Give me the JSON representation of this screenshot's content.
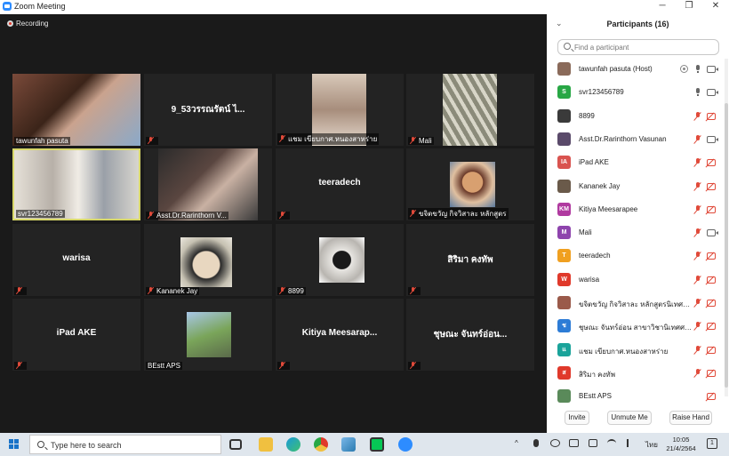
{
  "window": {
    "title": "Zoom Meeting",
    "minimize": "─",
    "restore": "❐",
    "close": "✕"
  },
  "recording_label": "Recording",
  "tiles": [
    {
      "label": "tawunfah pasuta",
      "bigname": "",
      "muted": false,
      "photo": "p1"
    },
    {
      "label": "",
      "bigname": "9_53วรรณรัตน์ ไ...",
      "muted": true,
      "photo": ""
    },
    {
      "label": "แชม เขียบกาศ.หนองสาหร่าย",
      "bigname": "",
      "muted": true,
      "photo": "p4"
    },
    {
      "label": "Mali",
      "bigname": "",
      "muted": true,
      "photo": "p5"
    },
    {
      "label": "svr123456789",
      "bigname": "",
      "muted": false,
      "photo": "p6",
      "active": true
    },
    {
      "label": "Asst.Dr.Rarinthorn V...",
      "bigname": "",
      "muted": true,
      "photo": "p7"
    },
    {
      "label": "",
      "bigname": "teeradech",
      "muted": true,
      "photo": ""
    },
    {
      "label": "ขจิตขวัญ กิจวิสาละ หลักสูตร",
      "bigname": "",
      "muted": true,
      "photo": "p9"
    },
    {
      "label": "",
      "bigname": "warisa",
      "muted": true,
      "photo": ""
    },
    {
      "label": "Kananek Jay",
      "bigname": "",
      "muted": true,
      "photo": "p12"
    },
    {
      "label": "8899",
      "bigname": "",
      "muted": true,
      "photo": "p15"
    },
    {
      "label": "",
      "bigname": "สิริมา คงทัพ",
      "muted": true,
      "photo": ""
    },
    {
      "label": "",
      "bigname": "iPad AKE",
      "muted": true,
      "photo": ""
    },
    {
      "label": "BEstt APS",
      "bigname": "",
      "muted": false,
      "photo": "p18"
    },
    {
      "label": "",
      "bigname": "Kitiya  Meesarap...",
      "muted": true,
      "photo": ""
    },
    {
      "label": "",
      "bigname": "ชุษณะ จันทร์อ่อน...",
      "muted": true,
      "photo": ""
    }
  ],
  "participants_panel": {
    "collapse_icon": "⌄",
    "title": "Participants (16)",
    "search_placeholder": "Find a participant",
    "participants": [
      {
        "name": "tawunfah pasuta (Host)",
        "initials": "",
        "color": "#8a6a5a",
        "mic": "on",
        "cam": "on",
        "host": true
      },
      {
        "name": "svr123456789",
        "initials": "S",
        "color": "#28a745",
        "mic": "on",
        "cam": "on"
      },
      {
        "name": "8899",
        "initials": "",
        "color": "#3a3a3a",
        "mic": "muted",
        "cam": "off"
      },
      {
        "name": "Asst.Dr.Rarinthorn Vasunan",
        "initials": "",
        "color": "#5a4a6a",
        "mic": "muted",
        "cam": "on"
      },
      {
        "name": "iPad AKE",
        "initials": "IA",
        "color": "#d9534f",
        "mic": "muted",
        "cam": "off"
      },
      {
        "name": "Kananek Jay",
        "initials": "",
        "color": "#6a5a4a",
        "mic": "muted",
        "cam": "off"
      },
      {
        "name": "Kitiya Meesarapee",
        "initials": "KM",
        "color": "#b03aa0",
        "mic": "muted",
        "cam": "off"
      },
      {
        "name": "Mali",
        "initials": "M",
        "color": "#8e44ad",
        "mic": "muted",
        "cam": "on"
      },
      {
        "name": "teeradech",
        "initials": "T",
        "color": "#f0a020",
        "mic": "muted",
        "cam": "off"
      },
      {
        "name": "warisa",
        "initials": "W",
        "color": "#e0392b",
        "mic": "muted",
        "cam": "off"
      },
      {
        "name": "ขจิตขวัญ กิจวิสาละ หลักสูตรนิเทศศา...",
        "initials": "",
        "color": "#9a5a4a",
        "mic": "muted",
        "cam": "off"
      },
      {
        "name": "ชุษณะ จันทร์อ่อน สาขาวิชานิเทศศาส...",
        "initials": "ช",
        "color": "#2d7cd6",
        "mic": "muted",
        "cam": "off"
      },
      {
        "name": "แชม เขียบกาศ.หนองสาหร่าย",
        "initials": "แ",
        "color": "#1aa39a",
        "mic": "muted",
        "cam": "off"
      },
      {
        "name": "สิริมา คงทัพ",
        "initials": "ส",
        "color": "#e0392b",
        "mic": "muted",
        "cam": "off"
      },
      {
        "name": "BEstt APS",
        "initials": "",
        "color": "#5a8a5a",
        "mic": "none",
        "cam": "off"
      }
    ],
    "buttons": {
      "invite": "Invite",
      "unmute_me": "Unmute Me",
      "raise_hand": "Raise Hand"
    }
  },
  "taskbar": {
    "search_text": "Type here to search",
    "language": "ไทย",
    "time": "10:05",
    "date": "21/4/2564",
    "notification_count": "1"
  }
}
